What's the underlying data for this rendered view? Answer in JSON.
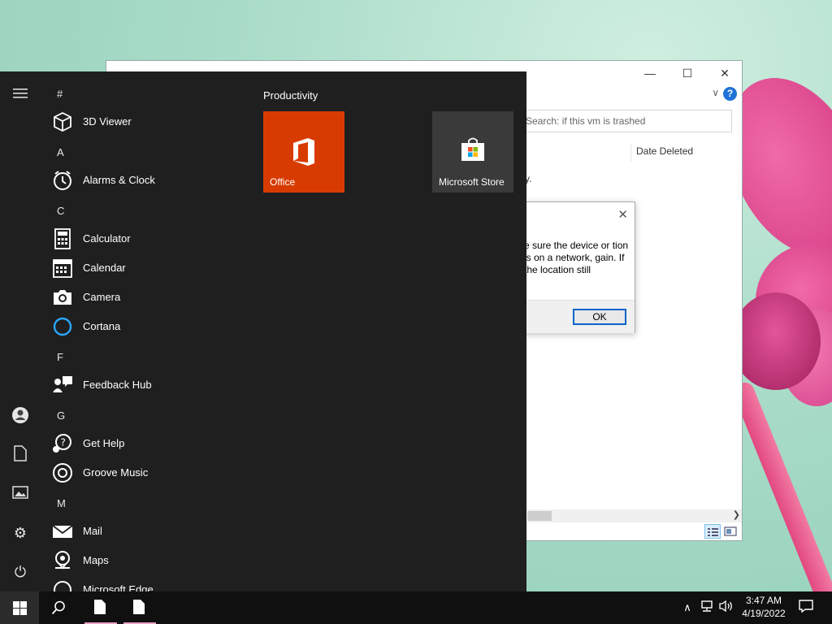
{
  "explorer": {
    "search_placeholder": "Search: if this vm is trashed",
    "column_date_deleted": "Date Deleted",
    "status_text": "y."
  },
  "dialog": {
    "message": "e sure the device or tion is on a network, gain. If the location still",
    "ok_label": "OK"
  },
  "start_menu": {
    "letters": [
      "#",
      "A",
      "C",
      "F",
      "G",
      "M"
    ],
    "apps": [
      {
        "name": "3D Viewer",
        "icon": "cube-icon"
      },
      {
        "name": "Alarms & Clock",
        "icon": "alarm-clock-icon"
      },
      {
        "name": "Calculator",
        "icon": "calculator-icon"
      },
      {
        "name": "Calendar",
        "icon": "calendar-icon"
      },
      {
        "name": "Camera",
        "icon": "camera-icon"
      },
      {
        "name": "Cortana",
        "icon": "cortana-icon"
      },
      {
        "name": "Feedback Hub",
        "icon": "feedback-icon"
      },
      {
        "name": "Get Help",
        "icon": "help-bubble-icon"
      },
      {
        "name": "Groove Music",
        "icon": "music-icon"
      },
      {
        "name": "Mail",
        "icon": "mail-icon"
      },
      {
        "name": "Maps",
        "icon": "map-pin-icon"
      },
      {
        "name": "Microsoft Edge",
        "icon": "edge-icon"
      }
    ],
    "group_title": "Productivity",
    "tiles": [
      {
        "label": "Office",
        "color": "#d83b01"
      },
      {
        "label": "Microsoft Store",
        "color": "#3a3a3a"
      }
    ]
  },
  "taskbar": {
    "time": "3:47 AM",
    "date": "4/19/2022"
  },
  "colors": {
    "start_bg": "#1f1f1f",
    "taskbar_bg": "#101010",
    "office_tile": "#d83b01",
    "accent_blue": "#0a64c9"
  }
}
